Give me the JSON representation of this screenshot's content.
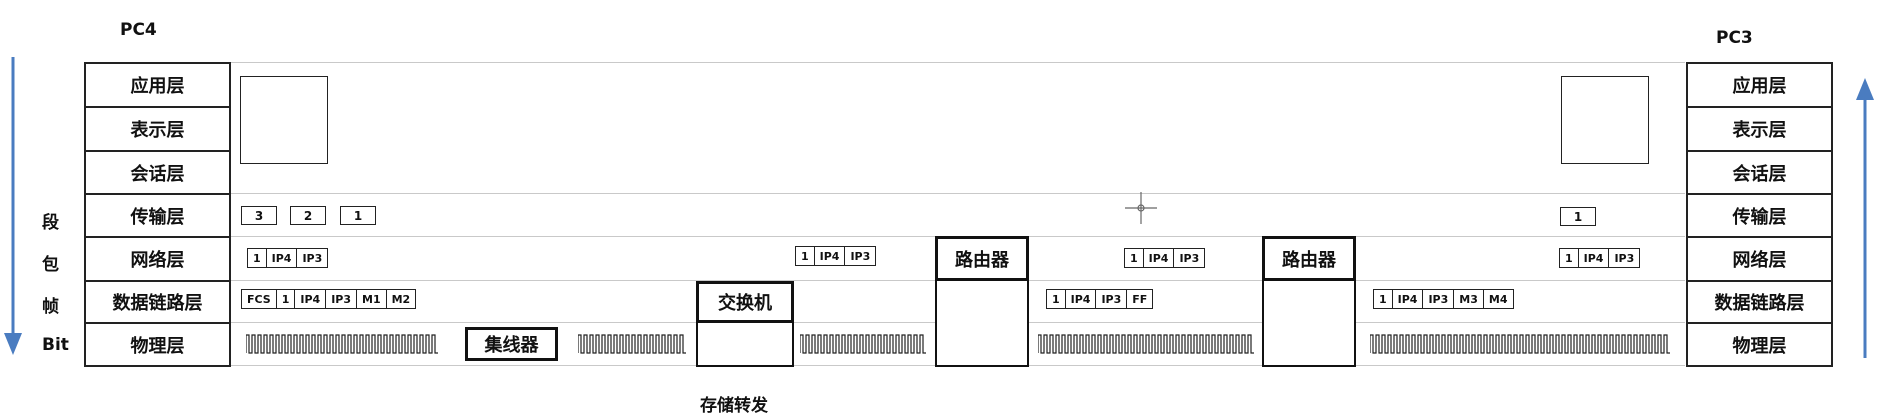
{
  "hosts": {
    "left": "PC4",
    "right": "PC3"
  },
  "layers": [
    "应用层",
    "表示层",
    "会话层",
    "传输层",
    "网络层",
    "数据链路层",
    "物理层"
  ],
  "pdu_labels": [
    "段",
    "包",
    "帧",
    "Bit"
  ],
  "devices": {
    "hub": "集线器",
    "switch": "交换机",
    "router1": "路由器",
    "router2": "路由器"
  },
  "caption": "存储转发",
  "segments_left": [
    "3",
    "2",
    "1"
  ],
  "segment_right": "1",
  "packet_left": [
    "1",
    "IP4",
    "IP3"
  ],
  "packet_mid": [
    "1",
    "IP4",
    "IP3"
  ],
  "packet_router_gap": [
    "1",
    "IP4",
    "IP3"
  ],
  "packet_right": [
    "1",
    "IP4",
    "IP3"
  ],
  "frame_left": [
    "FCS",
    "1",
    "IP4",
    "IP3",
    "M1",
    "M2"
  ],
  "frame_mid": [
    "1",
    "IP4",
    "IP3",
    "FF"
  ],
  "frame_right": [
    "1",
    "IP4",
    "IP3",
    "M3",
    "M4"
  ],
  "arrows": {
    "left_direction": "down",
    "right_direction": "up",
    "color": "#4a7cc0"
  }
}
